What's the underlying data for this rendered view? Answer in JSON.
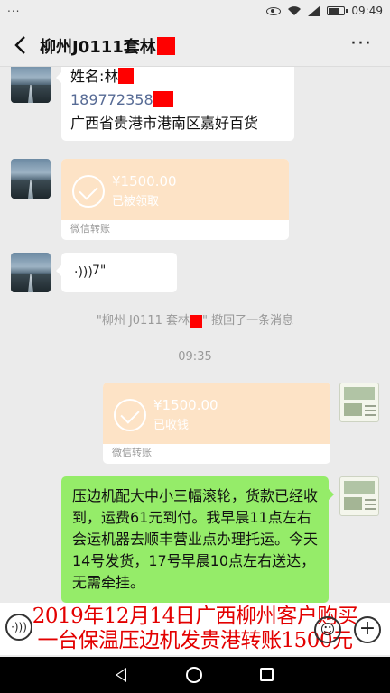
{
  "status_bar": {
    "time": "09:49",
    "left": "..."
  },
  "header": {
    "title": "柳州J0111套林",
    "more": "···"
  },
  "messages": {
    "contact_card": {
      "name": "姓名:林",
      "phone": "189772358",
      "address": "广西省贵港市港南区嘉好百货"
    },
    "transfer_received": {
      "amount": "¥1500.00",
      "status": "已被领取",
      "footer": "微信转账"
    },
    "voice": {
      "icon": "voice-icon",
      "duration": "7\""
    },
    "recall_notice": {
      "prefix": "\"柳州 J0111 套林",
      "suffix": "\" 撤回了一条消息"
    },
    "time_divider": "09:35",
    "transfer_sent": {
      "amount": "¥1500.00",
      "status": "已收钱",
      "footer": "微信转账"
    },
    "text_reply": "压边机配大中小三幅滚轮，货款已经收到，运费61元到付。我早晨11点左右会运机器去顺丰营业点办理托运。今天14号发货，17号早晨10点左右送达，无需牵挂。"
  },
  "caption": {
    "line1": "2019年12月14日广西柳州客户购买",
    "line2": "一台保温压边机发贵港转账1500元"
  },
  "input_bar": {
    "emoji": "☺",
    "plus": "+"
  }
}
